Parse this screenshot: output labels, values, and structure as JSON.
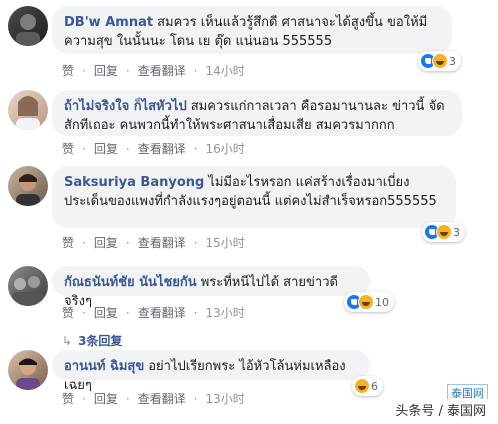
{
  "comments": [
    {
      "author": "DB'w Amnat",
      "text": "สมควร เห็นแล้วรู้สึกดี ศาสนาจะได้สูงขึ้น ขอให้มีความสุข ในนั้นนะ โดน เย ตุ๊ด แน่นอน 555555",
      "actions": {
        "like": "赞",
        "reply": "回复",
        "translate": "查看翻译",
        "time": "14小时"
      },
      "reactions": {
        "types": [
          "like-icon",
          "laugh-icon"
        ],
        "count": "3"
      }
    },
    {
      "author": "ถ้าไม่จริงใจ ก็ไสหัวไป",
      "text": "สมควรแก่กาลเวลา คือรอมานานละ ข่าวนี้ จัดสักทีเถอะ คนพวกนี้ทำให้พระศาสนาเสื่อมเสีย สมควรมากกก",
      "actions": {
        "like": "赞",
        "reply": "回复",
        "translate": "查看翻译",
        "time": "16小时"
      },
      "reactions": null
    },
    {
      "author": "Saksuriya Banyong",
      "text": "ไม่มีอะไรหรอก แค่สร้างเรื่องมาเบี่ยงประเด็นของแพงที่กำลังแรงๆอยู่ตอนนี้ แต่คงไม่สำเร็จหรอก555555",
      "actions": {
        "like": "赞",
        "reply": "回复",
        "translate": "查看翻译",
        "time": "15小时"
      },
      "reactions": {
        "types": [
          "like-icon",
          "laugh-icon"
        ],
        "count": "3"
      }
    },
    {
      "author": "กัณธนันท์ชัย นันไชยกัน",
      "text": "พระที่หนีไปได้ สายข่าวดีจริงๆ",
      "actions": {
        "like": "赞",
        "reply": "回复",
        "translate": "查看翻译",
        "time": "13小时"
      },
      "reactions": {
        "types": [
          "like-icon",
          "laugh-icon"
        ],
        "count": "10"
      },
      "replies": "3条回复"
    },
    {
      "author": "อานนท์ ฉิมสุข",
      "text": "อย่าไปเรียกพระ ไอ้หัวโล้นห่มเหลืองเฉยๆ",
      "actions": {
        "like": "赞",
        "reply": "回复",
        "translate": "查看翻译",
        "time": "13小时"
      },
      "reactions": {
        "types": [
          "laugh-icon"
        ],
        "count": "6"
      }
    }
  ],
  "watermark": "头条号 / 泰国网",
  "site_mark": "泰国网"
}
